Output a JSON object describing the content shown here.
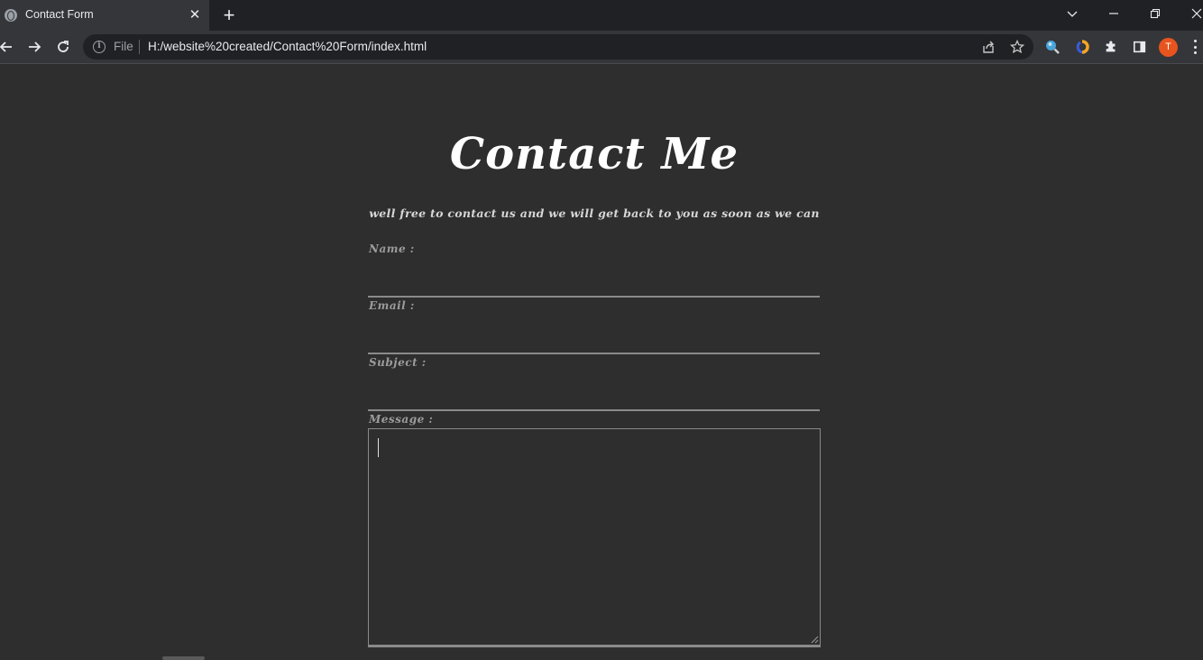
{
  "browser": {
    "tab": {
      "title": "Contact Form",
      "favicon": "globe-icon",
      "close_icon": "close-icon"
    },
    "new_tab_icon": "plus-icon",
    "window_controls": [
      "chevron-down-icon",
      "minimize-icon",
      "restore-icon",
      "close-icon"
    ],
    "address_bar": {
      "scheme_label": "File",
      "url": "H:/website%20created/Contact%20Form/index.html"
    },
    "toolbar_icons": [
      "back-arrow-icon",
      "forward-arrow-icon",
      "reload-icon",
      "info-icon",
      "share-icon",
      "star-icon",
      "magnifier-extension-icon",
      "colorful-extension-icon",
      "puzzle-extensions-icon",
      "side-panel-icon",
      "kebab-menu-icon"
    ],
    "profile": {
      "initial": "T",
      "color": "#e8541e"
    }
  },
  "form": {
    "heading": "Contact Me",
    "subheading": "well free to contact us and we will get back to you as soon as we can",
    "fields": {
      "name": {
        "label": "Name :",
        "value": ""
      },
      "email": {
        "label": "Email :",
        "value": ""
      },
      "subject": {
        "label": "Subject :",
        "value": ""
      },
      "message": {
        "label": "Message :",
        "value": ""
      }
    }
  },
  "colors": {
    "page_background": "#2e2e2e",
    "heading": "#ffffff",
    "label": "#9c9c9c",
    "underline": "#8a8a8a"
  }
}
